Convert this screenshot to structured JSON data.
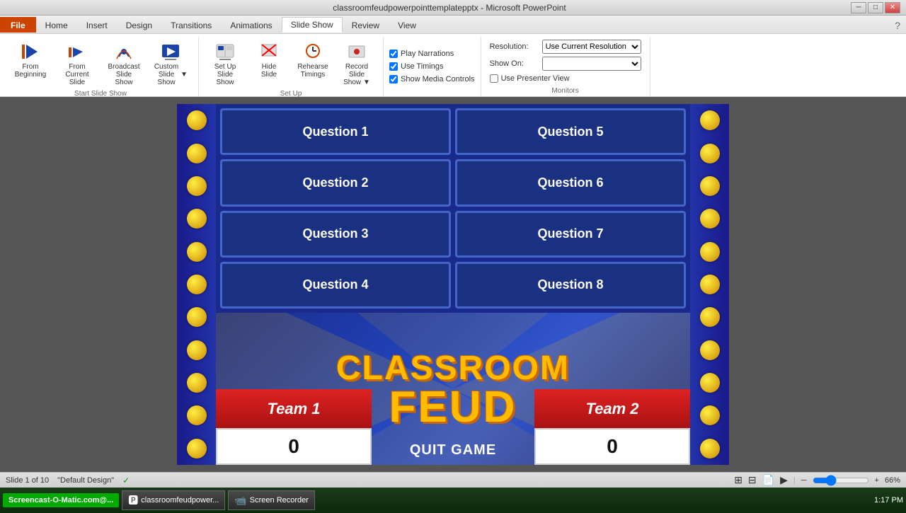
{
  "titlebar": {
    "title": "classroomfeudpowerpointtemplatepptx - Microsoft PowerPoint",
    "minimize": "─",
    "maximize": "□",
    "close": "✕"
  },
  "ribbon": {
    "tabs": [
      "File",
      "Home",
      "Insert",
      "Design",
      "Transitions",
      "Animations",
      "Slide Show",
      "Review",
      "View"
    ],
    "active_tab": "Slide Show",
    "groups": {
      "start_slideshow": {
        "label": "Start Slide Show",
        "buttons": [
          "From Beginning",
          "From Current Slide",
          "Broadcast Slide Show",
          "Custom Slide Show"
        ]
      },
      "setup": {
        "label": "Set Up",
        "buttons": [
          "Set Up Slide Show",
          "Hide Slide",
          "Rehearse Timings",
          "Record Slide Show"
        ]
      },
      "checkboxes": [
        "Play Narrations",
        "Use Timings",
        "Show Media Controls"
      ],
      "monitors_label": "Monitors",
      "resolution_label": "Resolution:",
      "resolution_value": "Use Current Resolution",
      "show_on_label": "Show On:",
      "show_on_value": "",
      "presenter_view_label": "Use Presenter View"
    }
  },
  "slide": {
    "questions": [
      {
        "id": 1,
        "label": "Question 1"
      },
      {
        "id": 2,
        "label": "Question 2"
      },
      {
        "id": 3,
        "label": "Question 3"
      },
      {
        "id": 4,
        "label": "Question 4"
      },
      {
        "id": 5,
        "label": "Question 5"
      },
      {
        "id": 6,
        "label": "Question 6"
      },
      {
        "id": 7,
        "label": "Question 7"
      },
      {
        "id": 8,
        "label": "Question 8"
      }
    ],
    "game_title_line1": "CLASSROOM",
    "game_title_line2": "FEUD",
    "team1": {
      "name": "Team 1",
      "score": "0"
    },
    "team2": {
      "name": "Team 2",
      "score": "0"
    },
    "quit_button": "QUIT GAME"
  },
  "statusbar": {
    "slide_info": "Slide 1 of 10",
    "theme": "\"Default Design\"",
    "checkmark": "✓",
    "zoom": "66%"
  },
  "taskbar": {
    "brand": "Screencast-O-Matic.com@...",
    "app1_icon": "🅿",
    "app1_label": "classroomfeudpower...",
    "app2_icon": "📹",
    "app2_label": "Screen Recorder",
    "time": "1:17 PM"
  }
}
